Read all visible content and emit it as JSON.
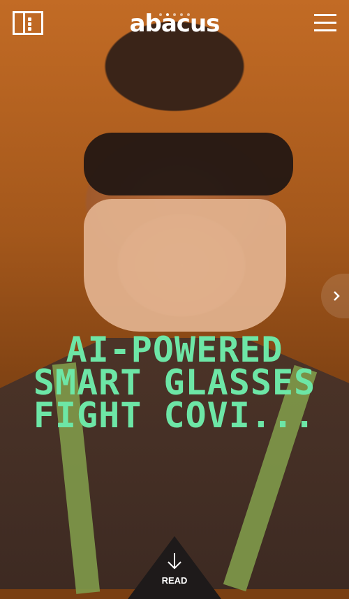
{
  "header": {
    "logo_text": "abacus",
    "sections_icon": "sections-icon",
    "menu_icon": "hamburger-menu-icon"
  },
  "carousel": {
    "pages": 5,
    "current": 2,
    "next_icon": "chevron-right-icon"
  },
  "article": {
    "headline": "AI-POWERED SMART GLASSES FIGHT COVI..."
  },
  "cta": {
    "read_label": "READ",
    "icon": "arrow-down-icon"
  },
  "colors": {
    "headline": "#6de6a6",
    "overlay": "#c26b25"
  }
}
